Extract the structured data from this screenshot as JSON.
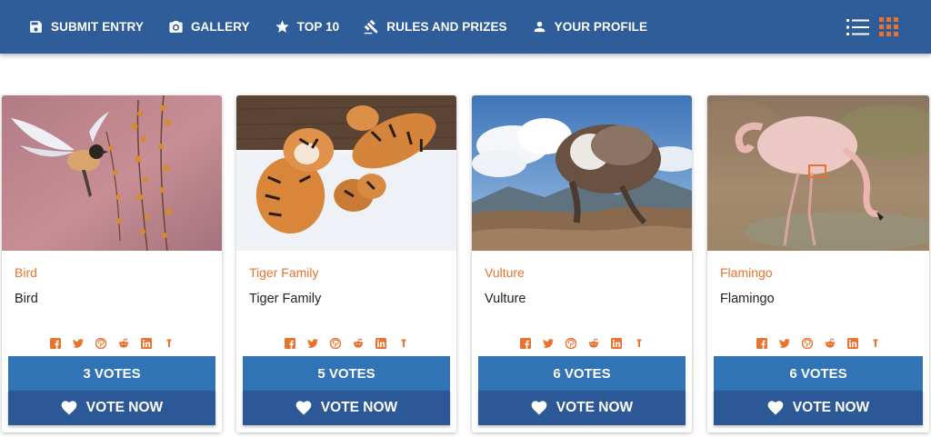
{
  "nav": {
    "items": [
      {
        "label": "Submit Entry",
        "icon": "save-icon"
      },
      {
        "label": "Gallery",
        "icon": "camera-icon"
      },
      {
        "label": "Top 10",
        "icon": "star-icon"
      },
      {
        "label": "Rules and Prizes",
        "icon": "gavel-icon"
      },
      {
        "label": "Your Profile",
        "icon": "user-icon"
      }
    ],
    "view_options": [
      "list-view-icon",
      "grid-view-icon"
    ],
    "active_view": "grid"
  },
  "colors": {
    "nav_bg": "#2f5d9a",
    "accent": "#e8732e",
    "votes_bg": "#3074b5",
    "vote_now_bg": "#2d5898"
  },
  "share_icons": [
    "facebook-icon",
    "twitter-icon",
    "pinterest-icon",
    "reddit-icon",
    "linkedin-icon",
    "tumblr-icon"
  ],
  "entries": [
    {
      "title": "Bird",
      "description": "Bird",
      "votes": "3 Votes",
      "vote_label": "Vote Now",
      "image": "bird-photo"
    },
    {
      "title": "Tiger Family",
      "description": "Tiger Family",
      "votes": "5 Votes",
      "vote_label": "Vote Now",
      "image": "tiger-family-photo"
    },
    {
      "title": "Vulture",
      "description": "Vulture",
      "votes": "6 Votes",
      "vote_label": "Vote Now",
      "image": "vulture-photo"
    },
    {
      "title": "Flamingo",
      "description": "Flamingo",
      "votes": "6 Votes",
      "vote_label": "Vote Now",
      "image": "flamingo-photo"
    }
  ]
}
